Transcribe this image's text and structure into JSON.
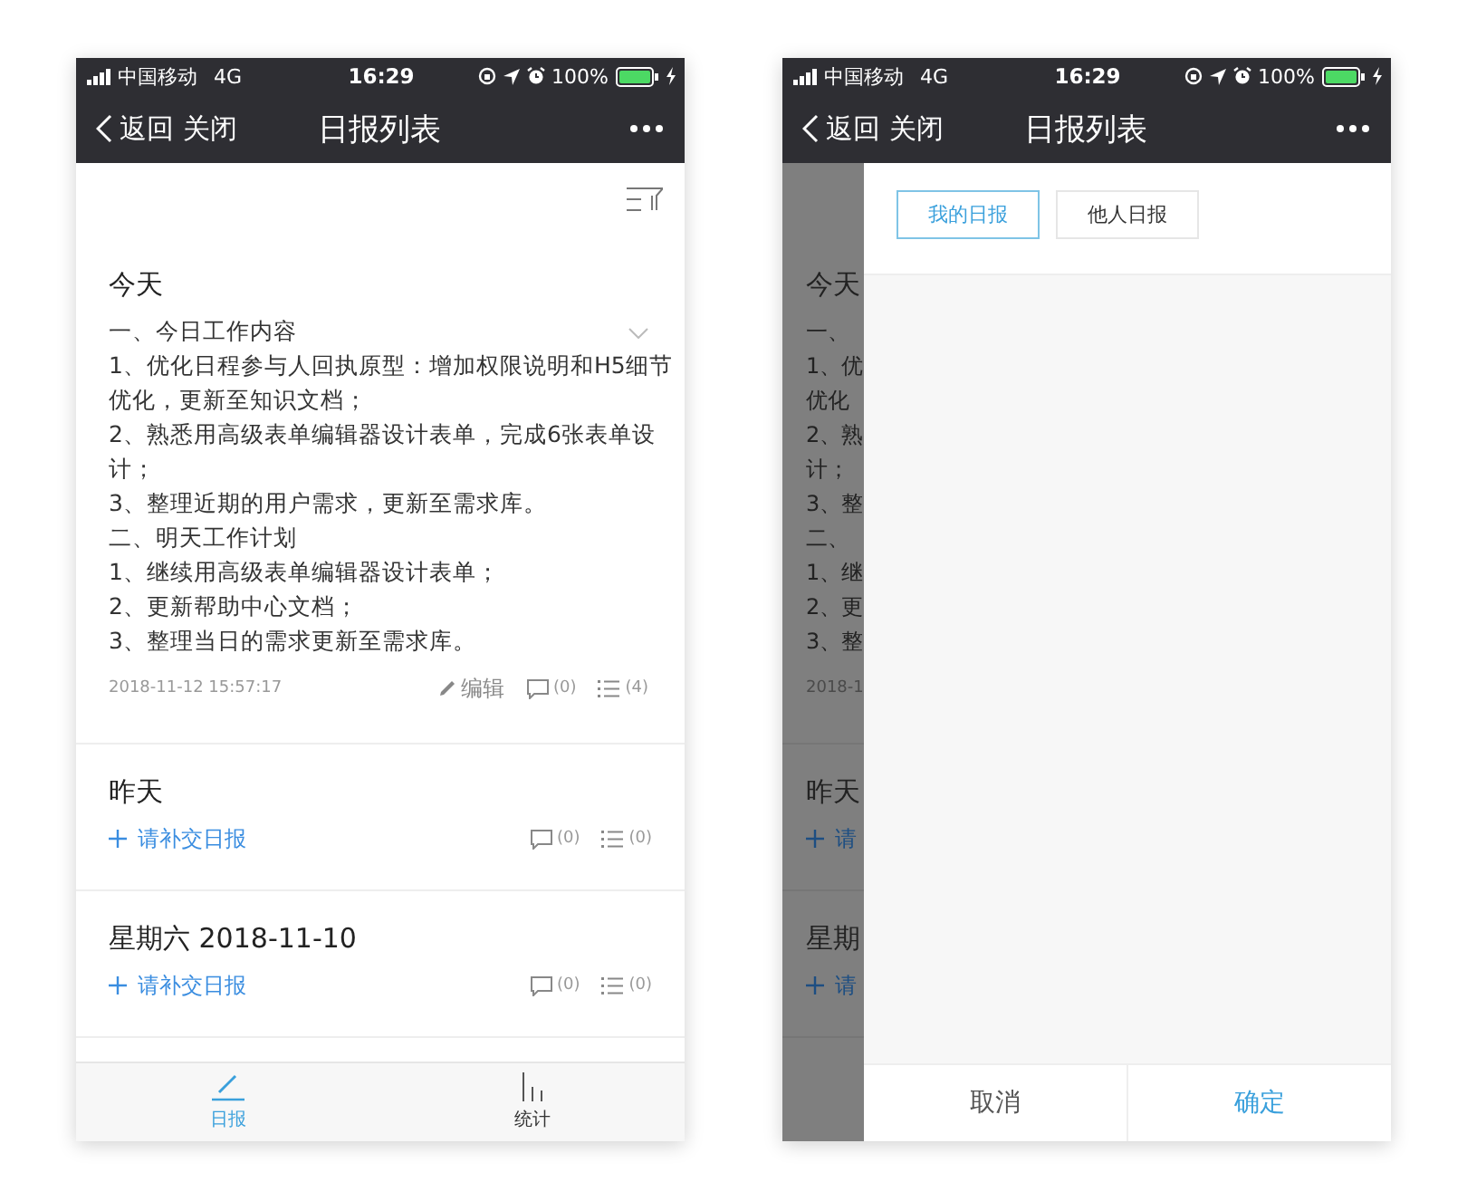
{
  "list_screen": {
    "status_bar": {
      "carrier": "中国移动",
      "network": "4G",
      "time": "16:29",
      "battery": "100%"
    },
    "nav_bar": {
      "back": "返回",
      "close": "关闭",
      "title": "日报列表"
    },
    "reports": [
      {
        "kind": "submitted",
        "title": "今天",
        "lines": [
          "一、今日工作内容",
          "1、优化日程参与人回执原型：增加权限说明和H5细节",
          "优化，更新至知识文档；",
          "2、熟悉用高级表单编辑器设计表单，完成6张表单设",
          "计；",
          "3、整理近期的用户需求，更新至需求库。",
          "二、明天工作计划",
          "1、继续用高级表单编辑器设计表单；",
          "2、更新帮助中心文档；",
          "3、整理当日的需求更新至需求库。"
        ],
        "timestamp": "2018-11-12 15:57:17",
        "edit": "编辑",
        "comments": "(0)",
        "items": "(4)"
      },
      {
        "kind": "missing",
        "title": "昨天",
        "link": "请补交日报",
        "comments": "(0)",
        "items": "(0)"
      },
      {
        "kind": "missing",
        "title": "星期六 2018-11-10",
        "link": "请补交日报",
        "comments": "(0)",
        "items": "(0)"
      }
    ],
    "tab_bar": [
      {
        "label": "日报",
        "selected": true
      },
      {
        "label": "统计",
        "selected": false
      }
    ]
  },
  "filter_screen": {
    "status_bar": {
      "carrier": "中国移动",
      "network": "4G",
      "time": "16:29",
      "battery": "100%"
    },
    "nav_bar": {
      "back": "返回",
      "close": "关闭",
      "title": "日报列表"
    },
    "dimmed_list": {
      "title": "今天",
      "lines": [
        "一、",
        "1、优",
        "优化",
        "2、熟",
        "计；",
        "3、整",
        "二、",
        "1、继",
        "2、更",
        "3、整"
      ],
      "timestamp": "2018-1",
      "reports": [
        {
          "title": "昨天",
          "link": "请"
        },
        {
          "title": "星期",
          "link": "请"
        }
      ]
    },
    "filter": {
      "options": [
        {
          "label": "我的日报",
          "selected": true
        },
        {
          "label": "他人日报",
          "selected": false
        }
      ],
      "buttons": [
        {
          "label": "取消",
          "kind": "cancel"
        },
        {
          "label": "确定",
          "kind": "confirm"
        }
      ]
    }
  }
}
